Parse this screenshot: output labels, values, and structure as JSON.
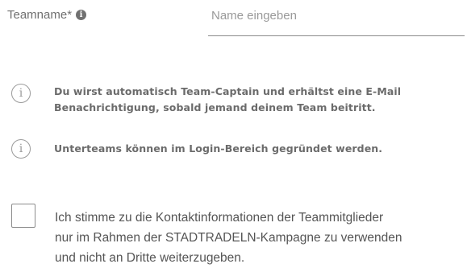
{
  "team_field": {
    "label": "Teamname*",
    "info_icon": "info-circle-solid-icon",
    "input_value": "",
    "input_placeholder": "Name eingeben"
  },
  "notices": [
    {
      "icon": "info-circle-outline-icon",
      "line1": "Du wirst automatisch Team-Captain und erhältst eine E-Mail",
      "line2": "Benachrichtigung, sobald jemand deinem Team beitritt."
    },
    {
      "icon": "info-circle-outline-icon",
      "line1": "Unterteams können im Login-Bereich gegründet werden."
    }
  ],
  "consent": {
    "checked": false,
    "line1": "Ich stimme zu die Kontaktinformationen der Teammitglieder",
    "line2": "nur im Rahmen der STADTRADELN-Kampagne zu verwenden",
    "line3": "und nicht an Dritte weiterzugeben."
  },
  "colors": {
    "label_text": "#707070",
    "notice_text": "#6b6b6b",
    "border": "#8a8a8a"
  }
}
